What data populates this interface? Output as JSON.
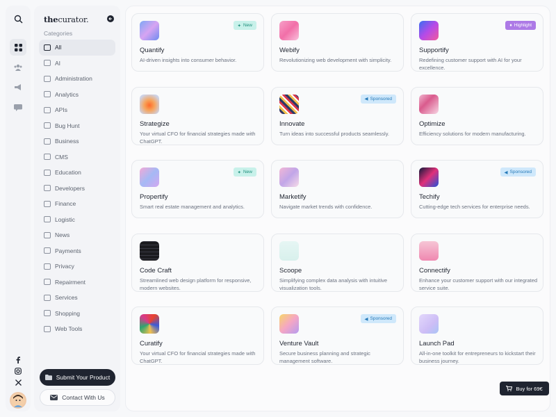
{
  "brand": {
    "bold": "the",
    "light": "curator."
  },
  "categories_title": "Categories",
  "categories": [
    "All",
    "AI",
    "Administration",
    "Analytics",
    "APIs",
    "Bug Hunt",
    "Business",
    "CMS",
    "Education",
    "Developers",
    "Finance",
    "Logistic",
    "News",
    "Payments",
    "Privacy",
    "Repairment",
    "Services",
    "Shopping",
    "Web Tools"
  ],
  "active_category": "All",
  "submit_label": "Submit Your Product",
  "contact_label": "Contact With Us",
  "buy_label": "Buy for 69€",
  "rail_icons": [
    "search-icon",
    "grid-icon",
    "users-icon",
    "megaphone-icon",
    "chat-icon"
  ],
  "social_icons": [
    "facebook-icon",
    "instagram-icon",
    "x-icon"
  ],
  "colors": {
    "dark": "#1f2430",
    "new_badge": "#c8f1ea",
    "sponsored_badge": "#cfe8fb",
    "highlight_badge": "#ad7ae6"
  },
  "products": [
    {
      "title": "Quantify",
      "desc": "AI-driven insights into consumer behavior.",
      "badge": "New",
      "badge_type": "new"
    },
    {
      "title": "Webify",
      "desc": "Revolutionizing web development with simplicity.",
      "badge": "",
      "badge_type": ""
    },
    {
      "title": "Supportify",
      "desc": "Redefining customer support with AI for your excellence.",
      "badge": "Highlight",
      "badge_type": "highlight"
    },
    {
      "title": "Strategize",
      "desc": "Your virtual CFO for financial strategies made with ChatGPT.",
      "badge": "",
      "badge_type": ""
    },
    {
      "title": "Innovate",
      "desc": "Turn ideas into successful products seamlessly.",
      "badge": "Sponsored",
      "badge_type": "sponsored"
    },
    {
      "title": "Optimize",
      "desc": "Efficiency solutions for modern manufacturing.",
      "badge": "",
      "badge_type": ""
    },
    {
      "title": "Propertify",
      "desc": "Smart real estate management and analytics.",
      "badge": "New",
      "badge_type": "new"
    },
    {
      "title": "Marketify",
      "desc": "Navigate market trends with confidence.",
      "badge": "",
      "badge_type": ""
    },
    {
      "title": "Techify",
      "desc": "Cutting-edge tech services for enterprise needs.",
      "badge": "Sponsored",
      "badge_type": "sponsored"
    },
    {
      "title": "Code Craft",
      "desc": "Streamlined web design platform for responsive, modern websites.",
      "badge": "",
      "badge_type": ""
    },
    {
      "title": "Scoope",
      "desc": "Simplifying complex data analysis with intuitive visualization tools.",
      "badge": "",
      "badge_type": ""
    },
    {
      "title": "Connectify",
      "desc": "Enhance your customer support with our integrated service suite.",
      "badge": "",
      "badge_type": ""
    },
    {
      "title": "Curatify",
      "desc": "Your virtual CFO for financial strategies made with ChatGPT.",
      "badge": "",
      "badge_type": ""
    },
    {
      "title": "Venture Vault",
      "desc": "Secure business planning and strategic management software.",
      "badge": "Sponsored",
      "badge_type": "sponsored"
    },
    {
      "title": "Launch Pad",
      "desc": "All-in-one toolkit for entrepreneurs to kickstart their business journey.",
      "badge": "",
      "badge_type": ""
    }
  ]
}
